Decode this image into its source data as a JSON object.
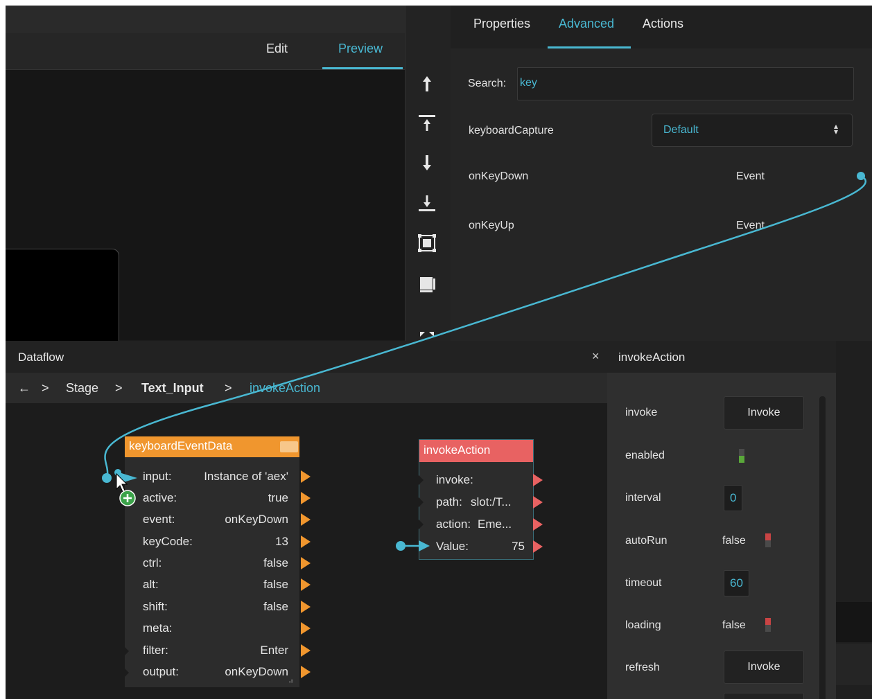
{
  "stage": {
    "tabs": [
      {
        "label": "Edit"
      },
      {
        "label": "Preview",
        "active": true
      }
    ]
  },
  "toolbar": {
    "icons": [
      "move-up-icon",
      "move-to-top-icon",
      "move-down-icon",
      "move-to-bottom-icon",
      "fit-icon",
      "fit-selection-icon",
      "expand-icon"
    ]
  },
  "properties": {
    "tabs": [
      {
        "label": "Properties"
      },
      {
        "label": "Advanced",
        "active": true
      },
      {
        "label": "Actions"
      }
    ],
    "search_label": "Search:",
    "search_value": "key",
    "rows": [
      {
        "name": "keyboardCapture",
        "value": "Default"
      },
      {
        "name": "onKeyDown",
        "value": "Event"
      },
      {
        "name": "onKeyUp",
        "value": "Event"
      }
    ]
  },
  "dataflow": {
    "title": "Dataflow",
    "close": "×",
    "breadcrumb": {
      "back": "←",
      "sep": ">",
      "items": [
        "Stage",
        "Text_Input",
        "invokeAction"
      ]
    },
    "keyboard_node": {
      "title": "keyboardEventData",
      "rows": [
        {
          "key": "input:",
          "value": "Instance of 'aex'"
        },
        {
          "key": "active:",
          "value": "true"
        },
        {
          "key": "event:",
          "value": "onKeyDown"
        },
        {
          "key": "keyCode:",
          "value": "13"
        },
        {
          "key": "ctrl:",
          "value": "false"
        },
        {
          "key": "alt:",
          "value": "false"
        },
        {
          "key": "shift:",
          "value": "false"
        },
        {
          "key": "meta:",
          "value": ""
        },
        {
          "key": "filter:",
          "value": "Enter"
        },
        {
          "key": "output:",
          "value": "onKeyDown"
        }
      ]
    },
    "invoke_node": {
      "title": "invokeAction",
      "rows": [
        {
          "key": "invoke:",
          "value": ""
        },
        {
          "key": "path:",
          "value": "slot:/T..."
        },
        {
          "key": "action:",
          "value": "Eme..."
        },
        {
          "key": "Value:",
          "value": "75"
        }
      ]
    }
  },
  "invoke_panel": {
    "title": "invokeAction",
    "rows": {
      "invoke": {
        "label": "invoke",
        "button": "Invoke"
      },
      "enabled": {
        "label": "enabled",
        "state": true
      },
      "interval": {
        "label": "interval",
        "value": "0"
      },
      "autoRun": {
        "label": "autoRun",
        "value": "false"
      },
      "timeout": {
        "label": "timeout",
        "value": "60"
      },
      "loading": {
        "label": "loading",
        "value": "false"
      },
      "refresh": {
        "label": "refresh",
        "button": "Invoke"
      }
    }
  },
  "colors": {
    "accent": "#49b8d2",
    "keyboard_node": "#f0962e",
    "invoke_node": "#e86262",
    "toggle_on": "#5aa83a",
    "toggle_off": "#c94444"
  }
}
